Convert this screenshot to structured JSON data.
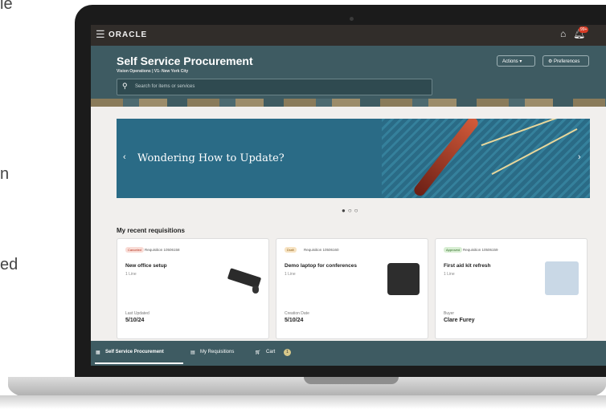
{
  "background_text": [
    "le",
    "n",
    "ed"
  ],
  "app": {
    "logo": "ORACLE",
    "notification_count": "99+"
  },
  "header": {
    "title": "Self Service Procurement",
    "subtitle": "Vision Operations | V1- New York City",
    "search_placeholder": "Search for items or services",
    "actions_label": "Actions",
    "preferences_label": "Preferences"
  },
  "banner": {
    "text": "Wondering How to Update?",
    "pages": 3,
    "active_page": 1
  },
  "recent": {
    "title": "My recent requisitions",
    "cards": [
      {
        "status": "Canceled",
        "requisition": "Requisition 10506158",
        "title": "New office setup",
        "lines": "1 Line",
        "label": "Last Updated",
        "value": "5/10/24"
      },
      {
        "status": "Draft",
        "requisition": "Requisition 10506160",
        "title": "Demo laptop for conferences",
        "lines": "1 Line",
        "label": "Creation Date",
        "value": "5/10/24"
      },
      {
        "status": "Approved",
        "requisition": "Requisition 10506159",
        "title": "First aid kit refresh",
        "lines": "1 Line",
        "label": "Buyer",
        "value": "Clare Furey"
      }
    ]
  },
  "bottom_nav": {
    "items": [
      "Self Service Procurement",
      "My Requisitions",
      "Cart"
    ],
    "cart_count": "1"
  },
  "colors": {
    "header": "#3e5b62",
    "topbar": "#312d2a",
    "banner": "#2a6b86"
  }
}
